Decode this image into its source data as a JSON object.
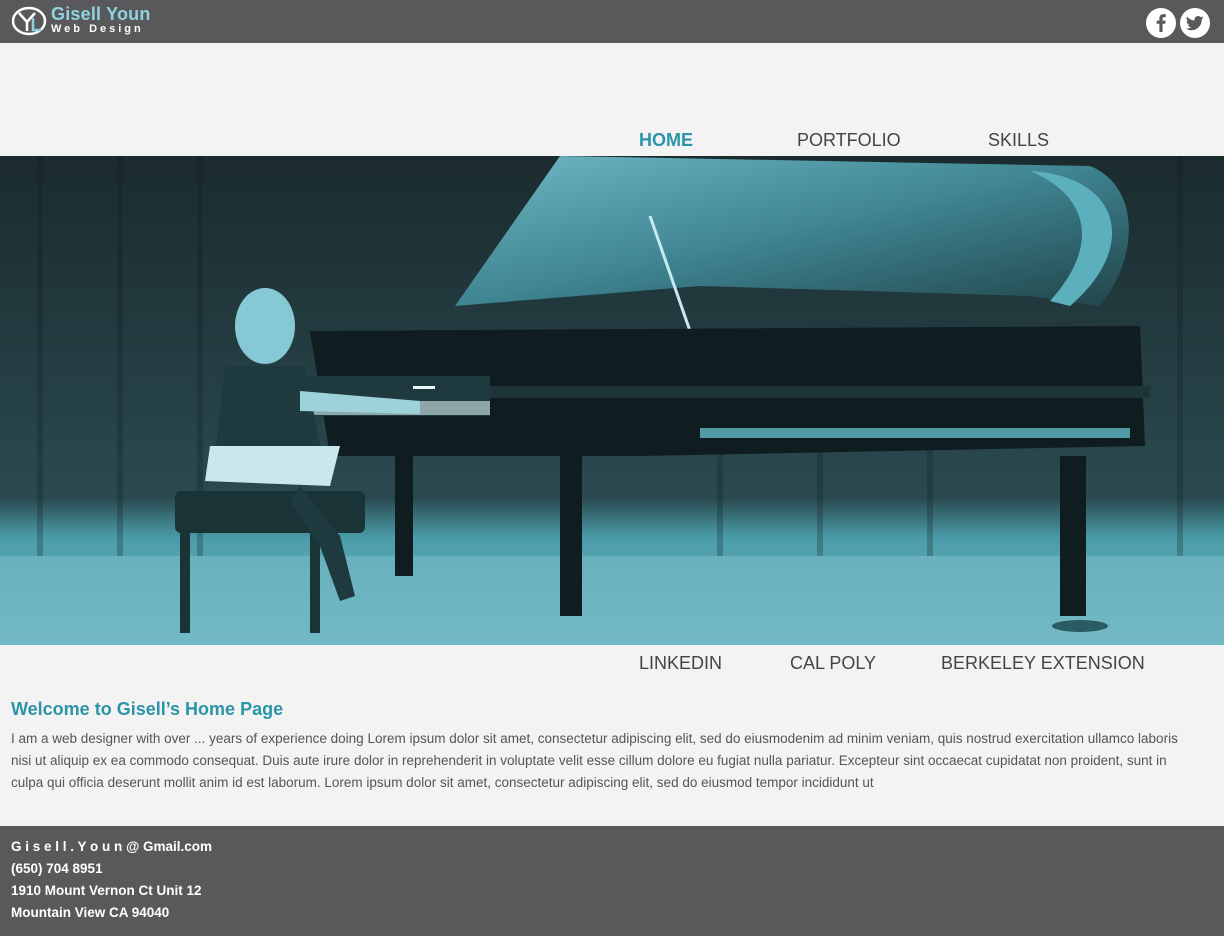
{
  "brand": {
    "name": "Gisell Youn",
    "subtitle": "Web Design"
  },
  "social": {
    "facebook_icon": "facebook-icon",
    "twitter_icon": "twitter-icon"
  },
  "nav_top": [
    "HOME",
    "PORTFOLIO",
    "SKILLS"
  ],
  "nav_bottom": [
    "LINKEDIN",
    "CAL POLY",
    "BERKELEY EXTENSION"
  ],
  "hero": {
    "subject": "child playing a grand piano on stage",
    "tint": "#2b94a8"
  },
  "welcome": {
    "title": "Welcome to Gisell’s Home Page",
    "body": "I am a web designer with over ... years of experience  doing Lorem ipsum dolor sit amet, consectetur adipiscing elit, sed do eiusmodenim ad minim veniam, quis nostrud exercitation ullamco laboris nisi ut aliquip ex ea commodo consequat. Duis aute irure dolor in reprehenderit in voluptate velit esse cillum dolore eu fugiat nulla pariatur. Excepteur sint occaecat cupidatat non proident, sunt in culpa qui officia deserunt mollit anim id est laborum.  Lorem ipsum dolor sit amet, consectetur adipiscing elit, sed do eiusmod tempor incididunt ut"
  },
  "footer": {
    "email_name": "G i s e l l . Y o u n",
    "email_domain": "@ Gmail.com",
    "phone": "(650) 704 8951",
    "address1": "1910 Mount Vernon Ct Unit 12",
    "address2": "Mountain View CA 94040"
  },
  "colors": {
    "accent": "#2b94a8",
    "bar": "#59595b",
    "background": "#f3f3f3"
  }
}
